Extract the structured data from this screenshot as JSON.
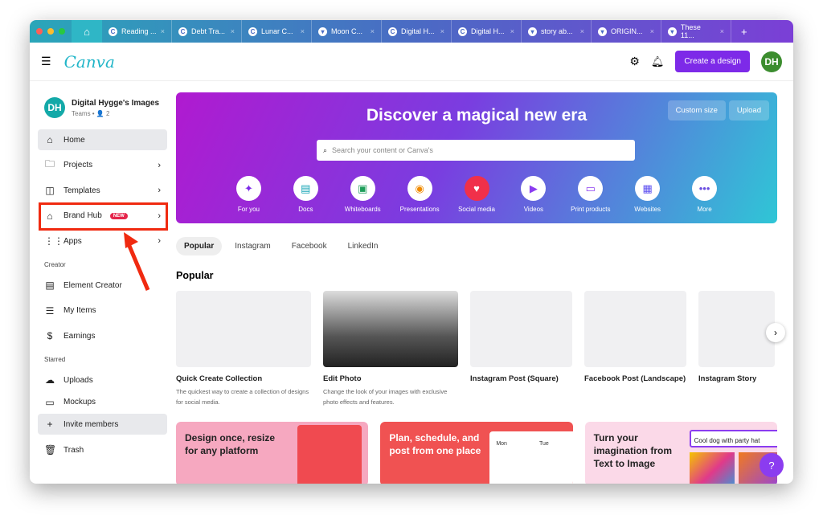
{
  "browser": {
    "tabs": [
      {
        "label": "Reading ..."
      },
      {
        "label": "Debt Tra..."
      },
      {
        "label": "Lunar C..."
      },
      {
        "label": "Moon C..."
      },
      {
        "label": "Digital H..."
      },
      {
        "label": "Digital H..."
      },
      {
        "label": "story ab..."
      },
      {
        "label": "ORIGIN..."
      },
      {
        "label": "These 11..."
      }
    ],
    "new_tab": "+",
    "close": "×"
  },
  "header": {
    "logo": "Canva",
    "create_label": "Create a design",
    "avatar": "DH"
  },
  "sidebar": {
    "team_name": "Digital Hygge's Images",
    "team_sub": "Teams • 👤 2",
    "avatar": "DH",
    "items": [
      {
        "label": "Home"
      },
      {
        "label": "Projects"
      },
      {
        "label": "Templates"
      },
      {
        "label": "Brand Hub",
        "badge": "NEW"
      },
      {
        "label": "Apps"
      }
    ],
    "creator_heading": "Creator",
    "creator_items": [
      {
        "label": "Element Creator"
      },
      {
        "label": "My Items"
      },
      {
        "label": "Earnings"
      }
    ],
    "starred_heading": "Starred",
    "starred_items": [
      {
        "label": "Uploads"
      },
      {
        "label": "Mockups"
      }
    ],
    "invite": "Invite members",
    "trash": "Trash"
  },
  "banner": {
    "title": "Discover a magical new era",
    "custom_size": "Custom size",
    "upload": "Upload",
    "search_placeholder": "Search your content or Canva's",
    "categories": [
      {
        "label": "For you",
        "color": "#7d2ae8"
      },
      {
        "label": "Docs",
        "color": "#13a3b5"
      },
      {
        "label": "Whiteboards",
        "color": "#1e9e5a"
      },
      {
        "label": "Presentations",
        "color": "#f08a00"
      },
      {
        "label": "Social media",
        "color": "#f0304a"
      },
      {
        "label": "Videos",
        "color": "#8b3cf0"
      },
      {
        "label": "Print products",
        "color": "#8b3cf0"
      },
      {
        "label": "Websites",
        "color": "#5d4ff0"
      },
      {
        "label": "More",
        "color": "#6a4de0"
      }
    ]
  },
  "filter_tabs": [
    "Popular",
    "Instagram",
    "Facebook",
    "LinkedIn"
  ],
  "popular": {
    "heading": "Popular",
    "cards": [
      {
        "title": "Quick Create Collection",
        "desc": "The quickest way to create a collection of designs for social media."
      },
      {
        "title": "Edit Photo",
        "desc": "Change the look of your images with exclusive photo effects and features."
      },
      {
        "title": "Instagram Post (Square)",
        "desc": ""
      },
      {
        "title": "Facebook Post (Landscape)",
        "desc": ""
      },
      {
        "title": "Instagram Story",
        "desc": ""
      }
    ]
  },
  "promos": [
    {
      "title": "Design once, resize for any platform"
    },
    {
      "title": "Plan, schedule, and post from one place",
      "days": [
        "Mon",
        "Tue"
      ]
    },
    {
      "title": "Turn your imagination from Text to Image",
      "prompt": "Cool dog with party hat"
    }
  ],
  "help": "?"
}
